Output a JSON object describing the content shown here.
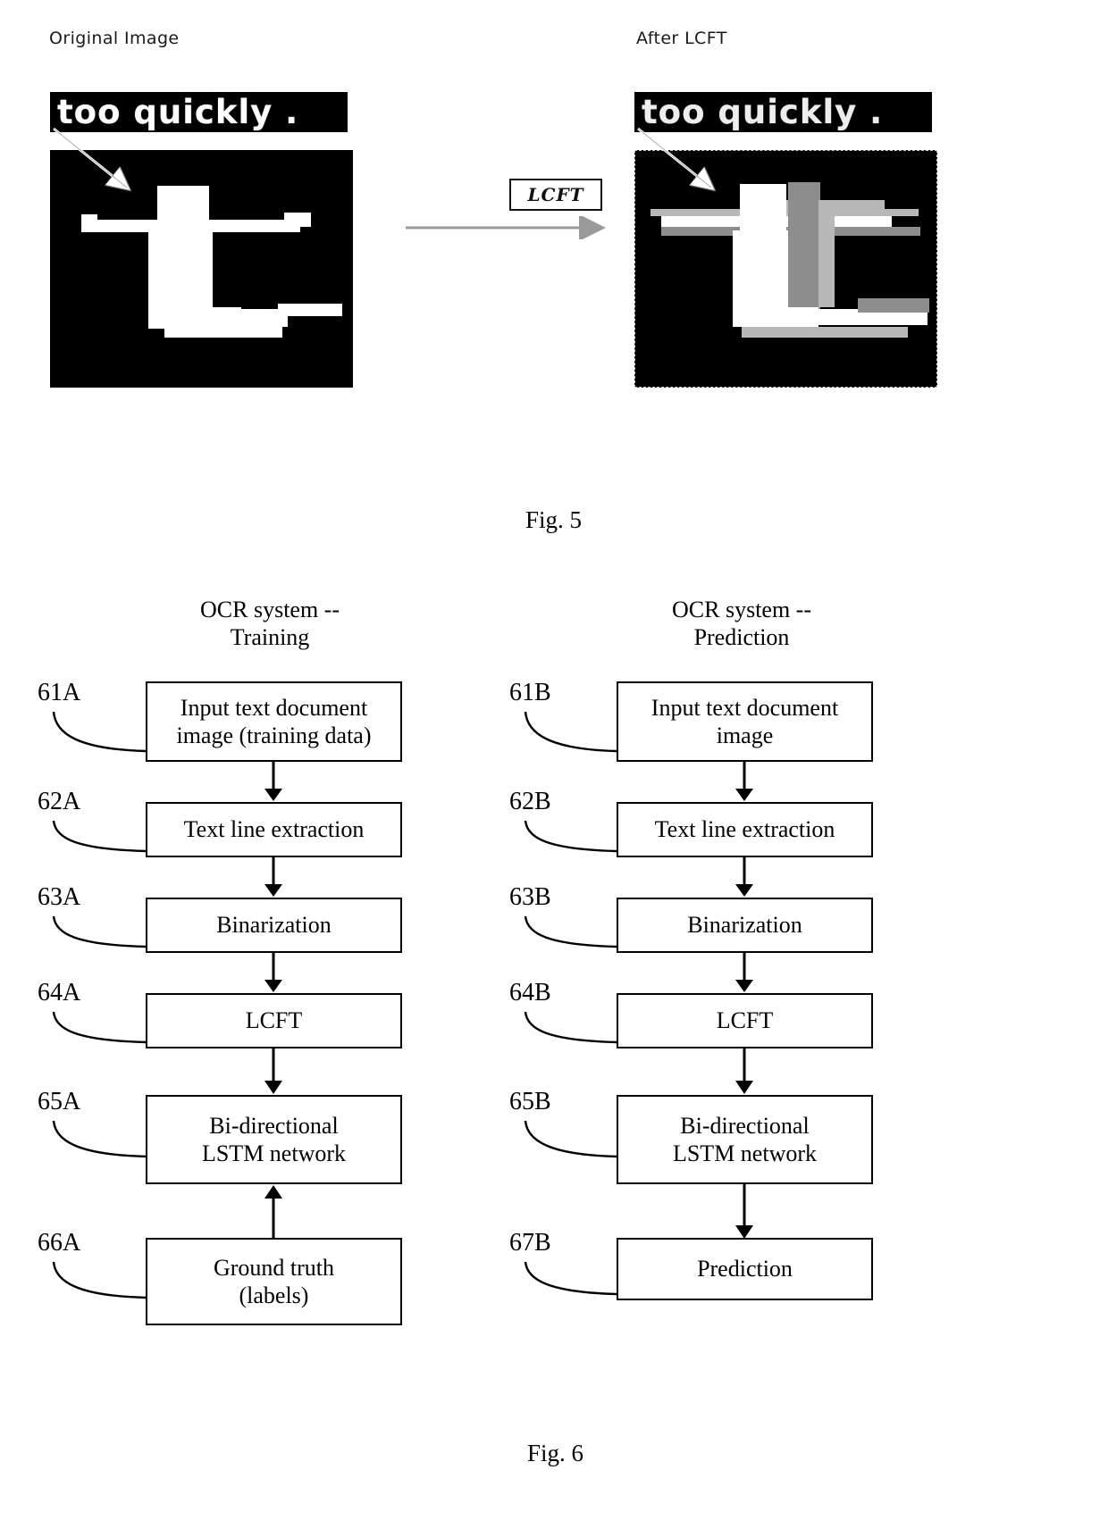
{
  "figure5": {
    "panel_labels": {
      "original": "Original Image",
      "after": "After LCFT"
    },
    "text_strip": "too quickly .",
    "transform_box_label": "LCFT",
    "caption": "Fig. 5"
  },
  "figure6": {
    "caption": "Fig. 6",
    "columns": [
      {
        "title": "OCR system --\nTraining",
        "steps": [
          {
            "ref": "61A",
            "label": "Input text document\nimage (training data)"
          },
          {
            "ref": "62A",
            "label": "Text line extraction"
          },
          {
            "ref": "63A",
            "label": "Binarization"
          },
          {
            "ref": "64A",
            "label": "LCFT"
          },
          {
            "ref": "65A",
            "label": "Bi-directional\nLSTM network"
          },
          {
            "ref": "66A",
            "label": "Ground truth\n(labels)"
          }
        ]
      },
      {
        "title": "OCR system --\nPrediction",
        "steps": [
          {
            "ref": "61B",
            "label": "Input text document\nimage"
          },
          {
            "ref": "62B",
            "label": "Text line extraction"
          },
          {
            "ref": "63B",
            "label": "Binarization"
          },
          {
            "ref": "64B",
            "label": "LCFT"
          },
          {
            "ref": "65B",
            "label": "Bi-directional\nLSTM network"
          },
          {
            "ref": "67B",
            "label": "Prediction"
          }
        ]
      }
    ]
  },
  "colors": {
    "ink": "#000000",
    "paper": "#ffffff"
  }
}
